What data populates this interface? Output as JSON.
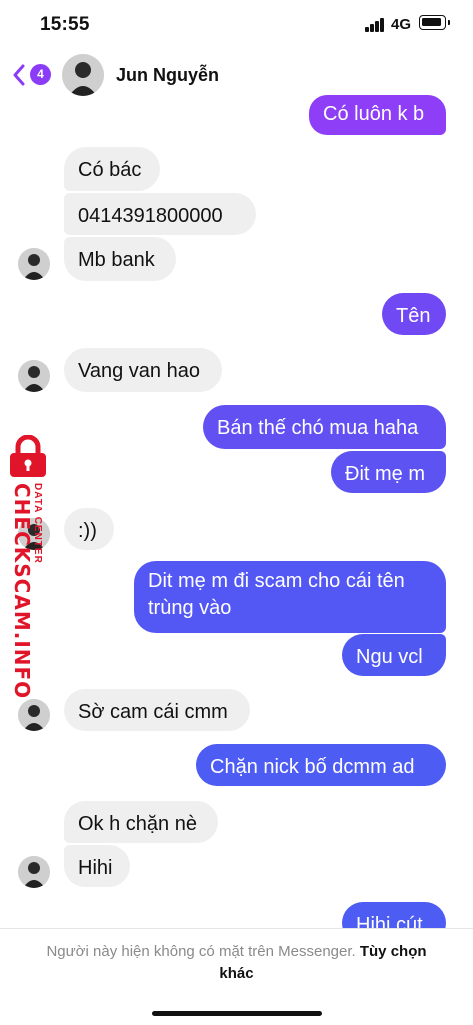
{
  "status_bar": {
    "time": "15:55",
    "network": "4G"
  },
  "header": {
    "back_badge": "4",
    "contact_name": "Jun Nguyễn"
  },
  "colors": {
    "outgoing_top": "#8e3ef7",
    "outgoing_bottom": "#4d5cf2",
    "incoming": "#efefef",
    "badge": "#8b3cf7",
    "watermark": "#e0152a"
  },
  "messages": [
    {
      "dir": "out",
      "text": "Có luôn k b"
    },
    {
      "dir": "in",
      "text": "Có bác"
    },
    {
      "dir": "in",
      "text": "0414391800000"
    },
    {
      "dir": "in",
      "text": "Mb bank"
    },
    {
      "dir": "out",
      "text": "Tên"
    },
    {
      "dir": "in",
      "text": "Vang van hao"
    },
    {
      "dir": "out",
      "text": "Bán thế chó mua haha"
    },
    {
      "dir": "out",
      "text": "Đit mẹ m"
    },
    {
      "dir": "in",
      "text": ":))"
    },
    {
      "dir": "out",
      "text_line1": "Dit mẹ m đi scam cho cái tên",
      "text_line2": "trùng vào"
    },
    {
      "dir": "out",
      "text": "Ngu vcl"
    },
    {
      "dir": "in",
      "text": "Sờ cam cái cmm"
    },
    {
      "dir": "out",
      "text": "Chặn nick bố dcmm ad"
    },
    {
      "dir": "in",
      "text": "Ok h chặn nè"
    },
    {
      "dir": "in",
      "text": "Hihi"
    },
    {
      "dir": "out",
      "text": "Hihi cút"
    }
  ],
  "watermark": {
    "brand": "CHECKSCAM.INFO",
    "tagline": "DATA CENTER"
  },
  "footer": {
    "notice": "Người này hiện không có mặt trên Messenger.",
    "link": "Tùy chọn khác"
  }
}
